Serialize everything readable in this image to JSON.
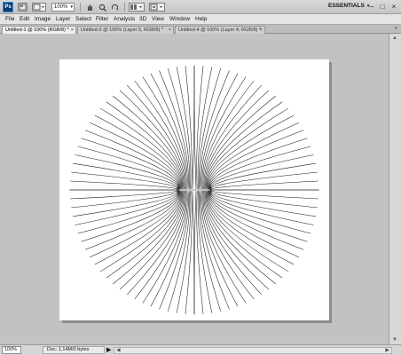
{
  "app": {
    "logo_text": "Ps",
    "toolbar": {
      "zoom_value": "100%",
      "zoom_arrow": "▾",
      "hand_icon": "hand-tool-icon",
      "zoom_icon": "magnifier-icon",
      "rotate_icon": "rotate-view-icon"
    },
    "workspace": {
      "label": "ESSENTIALS",
      "chevron": "▾"
    },
    "window_controls": [
      "–",
      "□",
      "×"
    ]
  },
  "menu": {
    "items": [
      "File",
      "Edit",
      "Image",
      "Layer",
      "Select",
      "Filter",
      "Analysis",
      "3D",
      "View",
      "Window",
      "Help"
    ]
  },
  "tabs": [
    {
      "label": "Untitled-1 @ 100% (RGB/8) *",
      "close": "×",
      "active": true
    },
    {
      "label": "Untitled-2 @ 100% (Layer 5, RGB/8) *",
      "close": "×",
      "active": false
    },
    {
      "label": "Untitled-4 @ 100% (Layer 4, RGB/8) *",
      "close": "×",
      "active": false
    }
  ],
  "tab_collapse": "»",
  "canvas": {
    "background": "#ffffff",
    "stroke_color": "#1a1a1a",
    "ray_count": 45
  },
  "status": {
    "zoom": "100%",
    "doc_info": "Doc: 1.14M/0 bytes",
    "arrow": "▶",
    "scroll_left": "◀",
    "scroll_right": "▶"
  },
  "scroll": {
    "up": "▲",
    "down": "▼"
  },
  "colors": {
    "app_bar": "#cfcfcf",
    "menu_bar": "#e4e4e4",
    "workarea": "#c2c2c2",
    "logo_bg": "#0a3a70"
  }
}
